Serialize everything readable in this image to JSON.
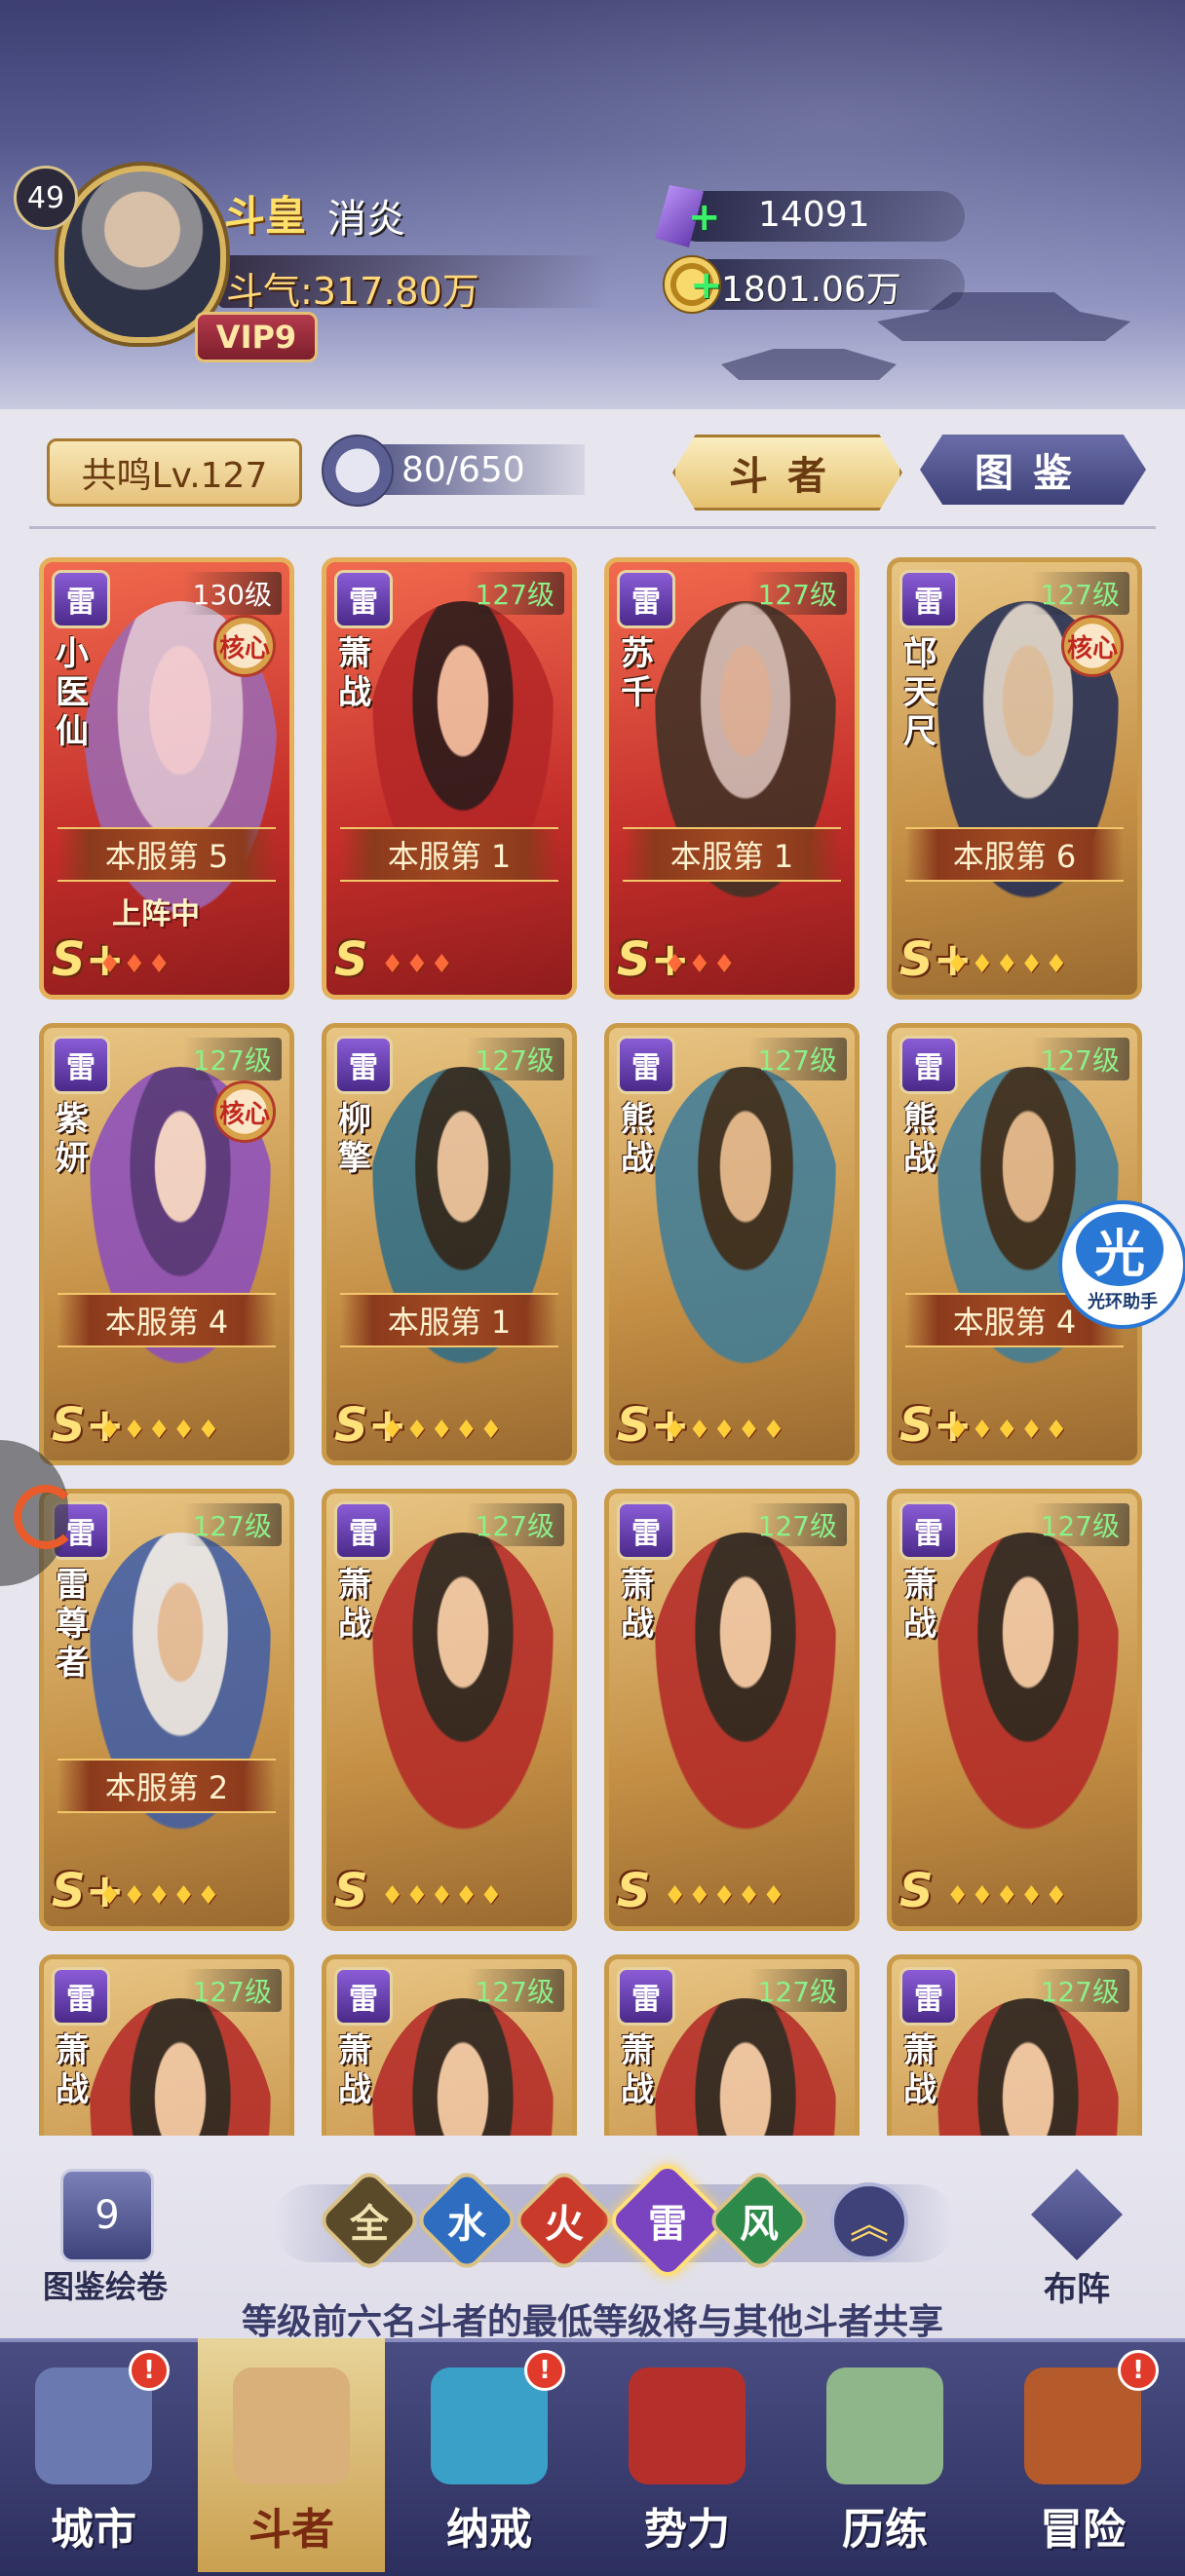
{
  "header": {
    "level": "49",
    "rank_title": "斗皇",
    "player_name": "消炎",
    "power": "斗气:317.80万",
    "vip": "VIP9",
    "gems": "14091",
    "gold": "1801.06万"
  },
  "toolbar": {
    "resonance": "共鸣Lv.127",
    "capacity": "80/650",
    "tab_fighters": "斗者",
    "tab_codex": "图鉴"
  },
  "cards": [
    {
      "element": "雷",
      "level": "130级",
      "name": "小医仙",
      "core": "核心",
      "rank": "本服第 5",
      "status": "上阵中",
      "grade": "S+",
      "stars": 3,
      "style": "red"
    },
    {
      "element": "雷",
      "level": "127级",
      "name": "萧战",
      "core": "",
      "rank": "本服第 1",
      "status": "",
      "grade": "S",
      "stars": 3,
      "style": "red"
    },
    {
      "element": "雷",
      "level": "127级",
      "name": "苏千",
      "core": "",
      "rank": "本服第 1",
      "status": "",
      "grade": "S+",
      "stars": 3,
      "style": "red"
    },
    {
      "element": "雷",
      "level": "127级",
      "name": "邙天尺",
      "core": "核心",
      "rank": "本服第 6",
      "status": "",
      "grade": "S+",
      "stars": 5,
      "style": "gold"
    },
    {
      "element": "雷",
      "level": "127级",
      "name": "紫妍",
      "core": "核心",
      "rank": "本服第 4",
      "status": "",
      "grade": "S+",
      "stars": 5,
      "style": "gold"
    },
    {
      "element": "雷",
      "level": "127级",
      "name": "柳擎",
      "core": "",
      "rank": "本服第 1",
      "status": "",
      "grade": "S+",
      "stars": 5,
      "style": "gold"
    },
    {
      "element": "雷",
      "level": "127级",
      "name": "熊战",
      "core": "",
      "rank": "",
      "status": "",
      "grade": "S+",
      "stars": 5,
      "style": "gold"
    },
    {
      "element": "雷",
      "level": "127级",
      "name": "熊战",
      "core": "",
      "rank": "本服第 4",
      "status": "",
      "grade": "S+",
      "stars": 5,
      "style": "gold"
    },
    {
      "element": "雷",
      "level": "127级",
      "name": "雷尊者",
      "core": "",
      "rank": "本服第 2",
      "status": "",
      "grade": "S+",
      "stars": 5,
      "style": "gold"
    },
    {
      "element": "雷",
      "level": "127级",
      "name": "萧战",
      "core": "",
      "rank": "",
      "status": "",
      "grade": "S",
      "stars": 5,
      "style": "gold"
    },
    {
      "element": "雷",
      "level": "127级",
      "name": "萧战",
      "core": "",
      "rank": "",
      "status": "",
      "grade": "S",
      "stars": 5,
      "style": "gold"
    },
    {
      "element": "雷",
      "level": "127级",
      "name": "萧战",
      "core": "",
      "rank": "",
      "status": "",
      "grade": "S",
      "stars": 5,
      "style": "gold"
    },
    {
      "element": "雷",
      "level": "127级",
      "name": "萧战",
      "core": "",
      "rank": "",
      "status": "",
      "grade": "",
      "stars": 0,
      "style": "gold"
    },
    {
      "element": "雷",
      "level": "127级",
      "name": "萧战",
      "core": "",
      "rank": "",
      "status": "",
      "grade": "",
      "stars": 0,
      "style": "gold"
    },
    {
      "element": "雷",
      "level": "127级",
      "name": "萧战",
      "core": "",
      "rank": "",
      "status": "",
      "grade": "",
      "stars": 0,
      "style": "gold"
    },
    {
      "element": "雷",
      "level": "127级",
      "name": "萧战",
      "core": "",
      "rank": "",
      "status": "",
      "grade": "",
      "stars": 0,
      "style": "gold"
    }
  ],
  "assistant": {
    "icon": "光",
    "label": "光环助手"
  },
  "bottom": {
    "codex_scroll": "图鉴绘卷",
    "filters": [
      "全",
      "水",
      "火",
      "雷",
      "风"
    ],
    "formation": "布阵",
    "notice": "等级前六名斗者的最低等级将与其他斗者共享"
  },
  "nav": [
    {
      "label": "城市",
      "badge": "!"
    },
    {
      "label": "斗者",
      "badge": ""
    },
    {
      "label": "纳戒",
      "badge": "!"
    },
    {
      "label": "势力",
      "badge": ""
    },
    {
      "label": "历练",
      "badge": ""
    },
    {
      "label": "冒险",
      "badge": "!"
    }
  ],
  "colors": {
    "accent_gold": "#d9b15a",
    "thunder_purple": "#7a44c0",
    "level_green": "#8cf08a"
  }
}
